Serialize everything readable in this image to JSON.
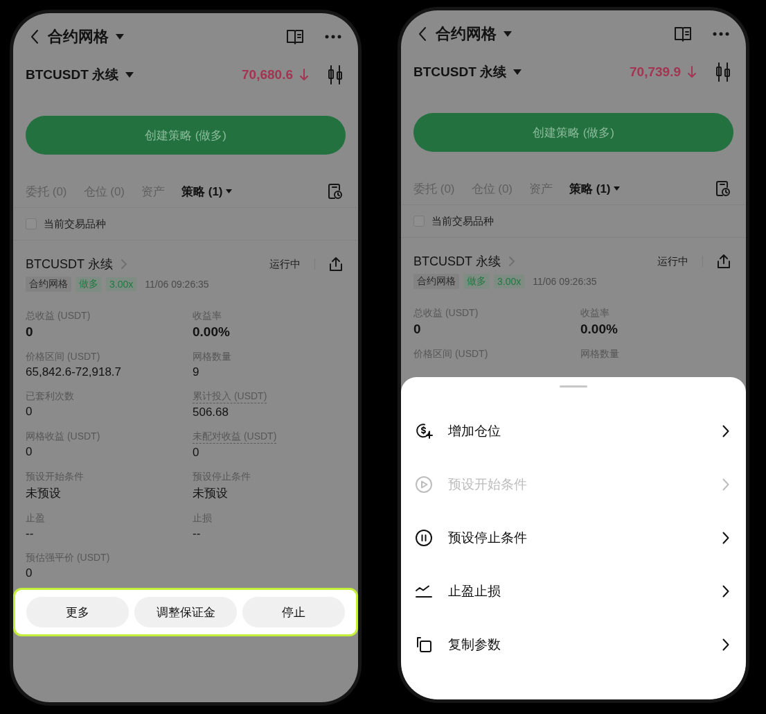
{
  "phones": [
    {
      "header": {
        "title": "合约网格"
      },
      "instrument": {
        "symbol": "BTCUSDT 永续",
        "price": "70,680.6"
      },
      "create_button": "创建策略 (做多)",
      "tabs": [
        {
          "label": "委托 (0)",
          "selected": false
        },
        {
          "label": "仓位 (0)",
          "selected": false
        },
        {
          "label": "资产",
          "selected": false
        },
        {
          "label": "策略 (1)",
          "selected": true
        }
      ],
      "filter": {
        "label": "当前交易品种",
        "checked": false
      },
      "strategy": {
        "name": "BTCUSDT 永续",
        "status": "运行中",
        "time": "11/06 09:26:35",
        "tags": [
          {
            "label": "合约网格",
            "kind": "neutral"
          },
          {
            "label": "做多",
            "kind": "long"
          },
          {
            "label": "3.00x",
            "kind": "long"
          }
        ]
      },
      "stats": [
        {
          "label": "总收益 (USDT)",
          "value": "0",
          "strong": true,
          "dotted": false
        },
        {
          "label": "收益率",
          "value": "0.00%",
          "strong": true,
          "dotted": false
        },
        {
          "label": "价格区间 (USDT)",
          "value": "65,842.6-72,918.7",
          "strong": false,
          "dotted": false
        },
        {
          "label": "网格数量",
          "value": "9",
          "strong": false,
          "dotted": false
        },
        {
          "label": "已套利次数",
          "value": "0",
          "strong": false,
          "dotted": false
        },
        {
          "label": "累计投入 (USDT)",
          "value": "506.68",
          "strong": false,
          "dotted": true
        },
        {
          "label": "网格收益 (USDT)",
          "value": "0",
          "strong": false,
          "dotted": false
        },
        {
          "label": "未配对收益 (USDT)",
          "value": "0",
          "strong": false,
          "dotted": true
        },
        {
          "label": "预设开始条件",
          "value": "未预设",
          "strong": false,
          "dotted": false
        },
        {
          "label": "预设停止条件",
          "value": "未预设",
          "strong": false,
          "dotted": false
        },
        {
          "label": "止盈",
          "value": "--",
          "strong": false,
          "dotted": false
        },
        {
          "label": "止损",
          "value": "--",
          "strong": false,
          "dotted": false
        },
        {
          "label": "预估强平价 (USDT)",
          "value": "0",
          "strong": false,
          "dotted": false
        }
      ],
      "action_bar": {
        "highlighted": true,
        "buttons": [
          "更多",
          "调整保证金",
          "停止"
        ]
      }
    },
    {
      "header": {
        "title": "合约网格"
      },
      "instrument": {
        "symbol": "BTCUSDT 永续",
        "price": "70,739.9"
      },
      "create_button": "创建策略 (做多)",
      "tabs": [
        {
          "label": "委托 (0)",
          "selected": false
        },
        {
          "label": "仓位 (0)",
          "selected": false
        },
        {
          "label": "资产",
          "selected": false
        },
        {
          "label": "策略 (1)",
          "selected": true
        }
      ],
      "filter": {
        "label": "当前交易品种",
        "checked": false
      },
      "strategy": {
        "name": "BTCUSDT 永续",
        "status": "运行中",
        "time": "11/06 09:26:35",
        "tags": [
          {
            "label": "合约网格",
            "kind": "neutral"
          },
          {
            "label": "做多",
            "kind": "long"
          },
          {
            "label": "3.00x",
            "kind": "long"
          }
        ]
      },
      "stats": [
        {
          "label": "总收益 (USDT)",
          "value": "0",
          "strong": true,
          "dotted": false
        },
        {
          "label": "收益率",
          "value": "0.00%",
          "strong": true,
          "dotted": false
        },
        {
          "label": "价格区间 (USDT)",
          "strong": false,
          "dotted": false
        },
        {
          "label": "网格数量",
          "strong": false,
          "dotted": false
        }
      ],
      "sheet": {
        "items": [
          {
            "label": "增加仓位",
            "disabled": false
          },
          {
            "label": "预设开始条件",
            "disabled": true
          },
          {
            "label": "预设停止条件",
            "disabled": false
          },
          {
            "label": "止盈止损",
            "disabled": false
          },
          {
            "label": "复制参数",
            "disabled": false
          }
        ]
      }
    }
  ]
}
